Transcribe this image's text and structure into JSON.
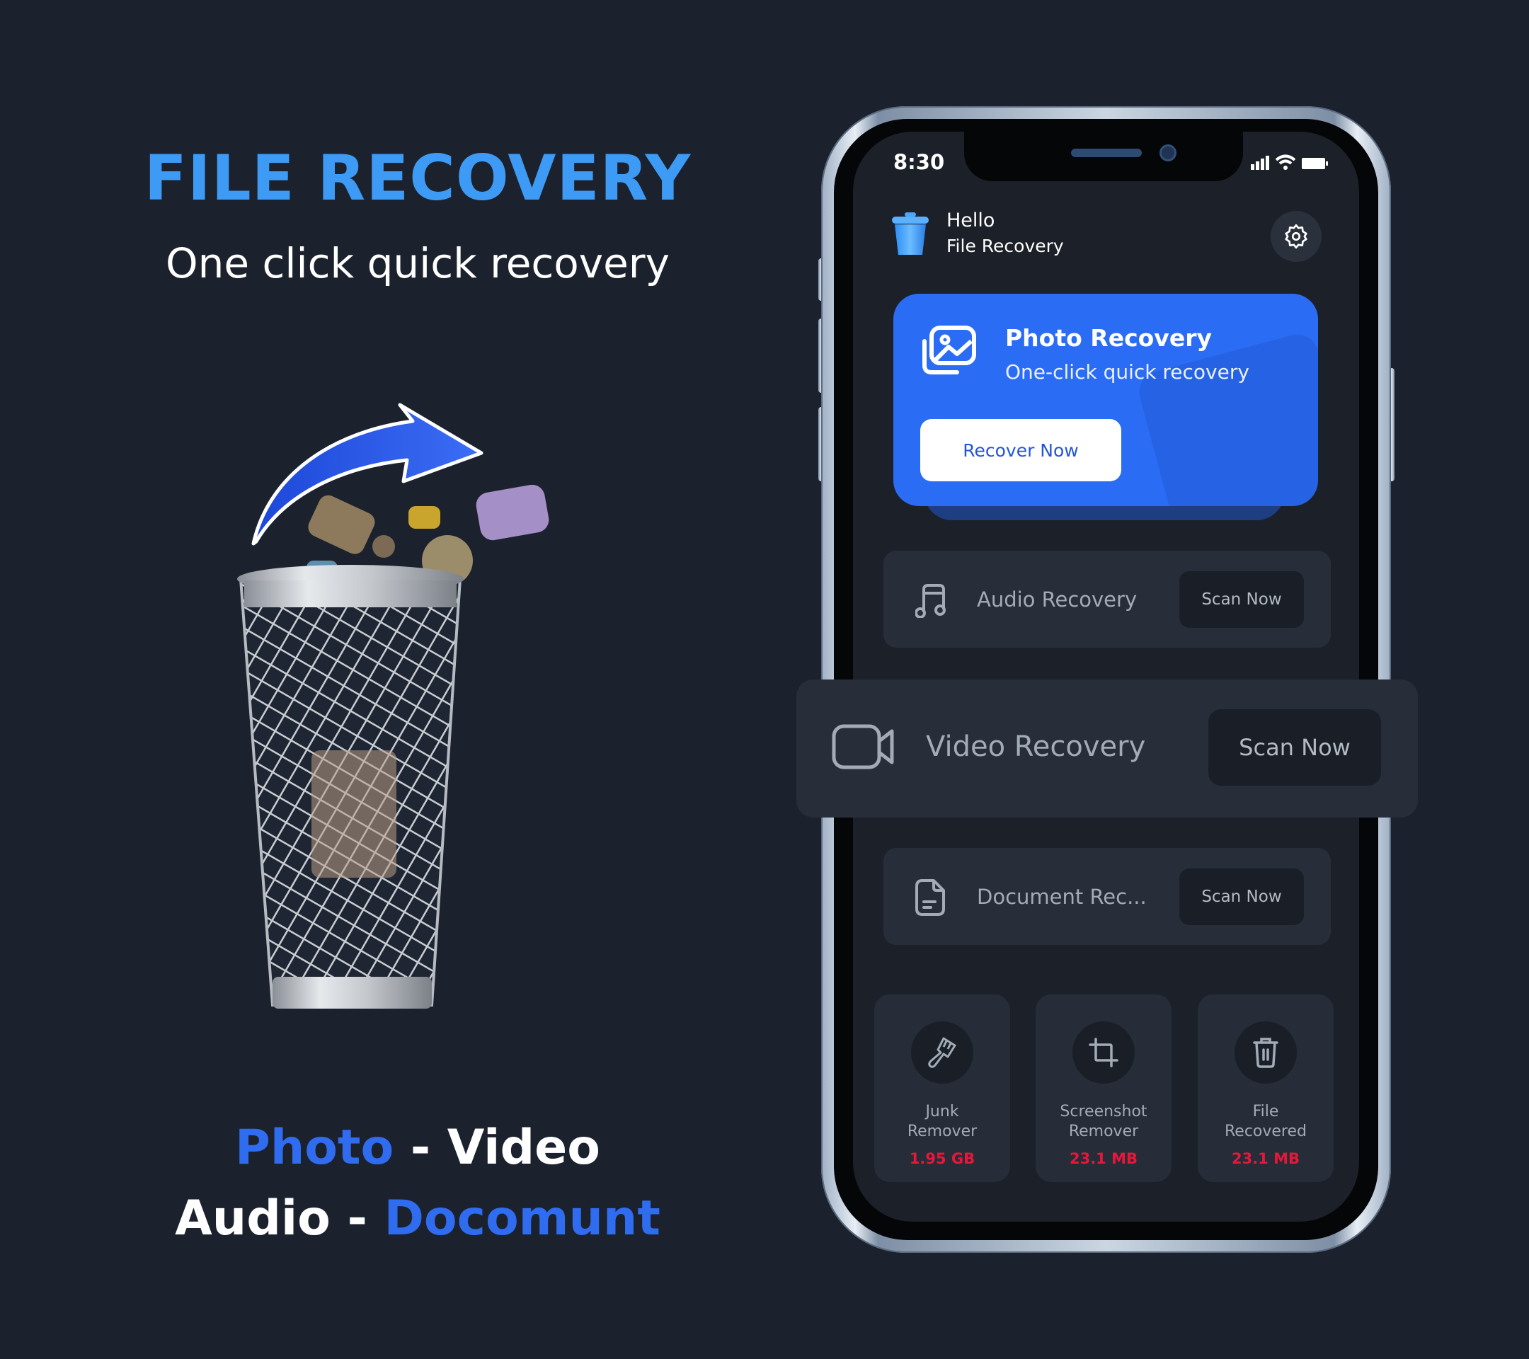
{
  "hero": {
    "title": "FILE RECOVERY",
    "subtitle": "One click quick recovery"
  },
  "tagline": {
    "line1": [
      {
        "text": "Photo",
        "color": "blue"
      },
      {
        "text": " - Video",
        "color": "white"
      }
    ],
    "line2": [
      {
        "text": "Audio - ",
        "color": "white"
      },
      {
        "text": "Docomunt",
        "color": "blue"
      }
    ]
  },
  "illustration": {
    "description": "Metal wire trash basket with photo thumbnails flying out along a curved blue arrow",
    "icons": [
      "recover-arrow-icon",
      "trash-basket-icon",
      "photo-thumbnail"
    ]
  },
  "phone": {
    "status_bar": {
      "time": "8:30",
      "icons": [
        "signal-icon",
        "wifi-icon",
        "battery-icon"
      ]
    },
    "header": {
      "greeting": "Hello",
      "app_name": "File Recovery",
      "logo_icon": "trash-bin-icon",
      "settings_icon": "gear-icon"
    },
    "photo_card": {
      "title": "Photo Recovery",
      "subtitle": "One-click quick recovery",
      "button_label": "Recover Now",
      "icon": "gallery-icon"
    },
    "recovery_rows": [
      {
        "label": "Audio Recovery",
        "button": "Scan Now",
        "icon": "music-note-icon"
      },
      {
        "label": "Video Recovery",
        "button": "Scan Now",
        "icon": "video-camera-icon"
      },
      {
        "label": "Document Rec...",
        "button": "Scan Now",
        "icon": "document-icon"
      }
    ],
    "tiles": [
      {
        "label_line1": "Junk",
        "label_line2": "Remover",
        "value": "1.95 GB",
        "icon": "brush-icon"
      },
      {
        "label_line1": "Screenshot",
        "label_line2": "Remover",
        "value": "23.1 MB",
        "icon": "crop-icon"
      },
      {
        "label_line1": "File",
        "label_line2": "Recovered",
        "value": "23.1 MB",
        "icon": "trash-icon"
      }
    ]
  },
  "colors": {
    "background": "#1c222d",
    "title_blue": "#3d9bf5",
    "accent_blue": "#2b6cf5",
    "tagline_blue": "#2f6cf0",
    "card": "#272e39",
    "value_red": "#e8173a"
  }
}
